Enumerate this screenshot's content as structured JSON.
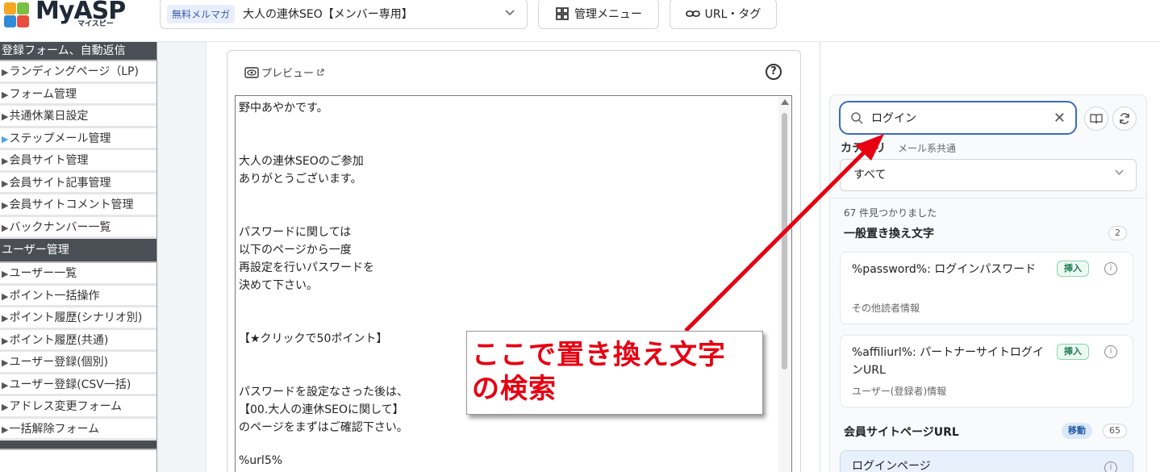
{
  "header": {
    "logo_text": "MyASP",
    "logo_sub": "マイスピー",
    "magazine_badge": "無料メルマガ",
    "magazine_name": "大人の連休SEO【メンバー専用】",
    "menu_button": "管理メニュー",
    "url_button": "URL・タグ"
  },
  "sidebar": {
    "section1_title": "登録フォーム、自動返信",
    "section1_items": [
      {
        "label": "ランディングページ（LP)"
      },
      {
        "label": "フォーム管理"
      },
      {
        "label": "共通休業日設定"
      },
      {
        "label": "ステップメール管理"
      },
      {
        "label": "会員サイト管理"
      },
      {
        "label": "会員サイト記事管理"
      },
      {
        "label": "会員サイトコメント管理"
      },
      {
        "label": "バックナンバー一覧"
      }
    ],
    "section2_title": "ユーザー管理",
    "section2_items": [
      {
        "label": "ユーザー一覧"
      },
      {
        "label": "ポイント一括操作"
      },
      {
        "label": "ポイント履歴(シナリオ別)"
      },
      {
        "label": "ポイント履歴(共通)"
      },
      {
        "label": "ユーザー登録(個別)"
      },
      {
        "label": "ユーザー登録(CSV一括)"
      },
      {
        "label": "アドレス変更フォーム"
      },
      {
        "label": "一括解除フォーム"
      }
    ]
  },
  "editor": {
    "preview_label": "プレビュー",
    "lines": [
      "野中あやかです。",
      "大人の連休SEOのご参加",
      "ありがとうございます。",
      "パスワードに関しては",
      "以下のページから一度",
      "再設定を行いパスワードを",
      "決めて下さい。",
      "【★クリックで50ポイント】",
      "パスワードを設定なさった後は、",
      "【00.大人の連休SEOに関して】",
      "のページをまずはご確認下さい。",
      "%url5%"
    ]
  },
  "replace_panel": {
    "search_value": "ログイン",
    "category_label": "カテゴリ",
    "category_sub": "メール系共通",
    "category_value": "すべて",
    "results_count": "67 件見つかりました",
    "groups": [
      {
        "title": "一般置き換え文字",
        "count": "2",
        "items": [
          {
            "title": "%password%: ログインパスワード",
            "desc": "その他読者情報",
            "action": "挿入"
          },
          {
            "title": "%affiliurl%: パートナーサイトログインURL",
            "desc": "ユーザー(登録者)情報",
            "action": "挿入"
          }
        ]
      },
      {
        "title": "会員サイトページURL",
        "count": "65",
        "move": "移動",
        "items": [
          {
            "title": "ログインページ"
          }
        ]
      }
    ]
  },
  "callout": {
    "line1": "ここで置き換え文字",
    "line2": "の検索"
  },
  "colors": {
    "accent_blue": "#3b6bbf",
    "sidebar_header": "#4a4f55",
    "callout_red": "#e60012",
    "insert_green": "#1f7a52"
  }
}
